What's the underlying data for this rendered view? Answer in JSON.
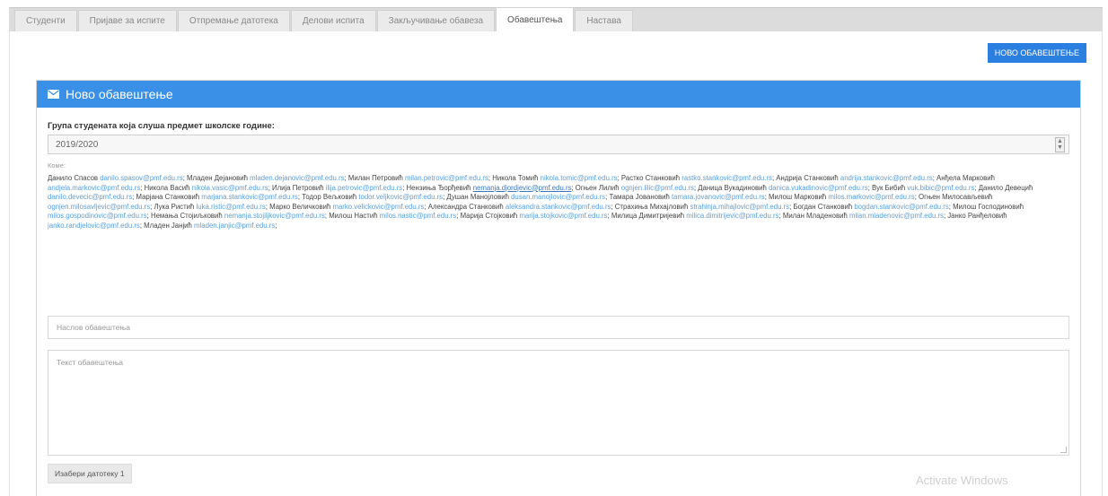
{
  "tabs": [
    {
      "label": "Студенти",
      "active": false
    },
    {
      "label": "Пријаве за испите",
      "active": false
    },
    {
      "label": "Отпремање датотека",
      "active": false
    },
    {
      "label": "Делови испита",
      "active": false
    },
    {
      "label": "Закључивање обавеза",
      "active": false
    },
    {
      "label": "Обавештења",
      "active": true
    },
    {
      "label": "Настава",
      "active": false
    }
  ],
  "new_notice_button": "НОВО ОБАВЕШТЕЊЕ",
  "panel": {
    "title": "Ново обавештење",
    "group_label": "Група студената која слуша предмет школске године:",
    "group_value": "2019/2020",
    "to_label": "Коме:",
    "recipients": [
      {
        "name": "Данило Спасов",
        "email": "danilo.spasov@pmf.edu.rs"
      },
      {
        "name": "Младен Дејановић",
        "email": "mladen.dejanovic@pmf.edu.rs"
      },
      {
        "name": "Милан Петровић",
        "email": "milan.petrovic@pmf.edu.rs"
      },
      {
        "name": "Никола Томић",
        "email": "nikola.tomic@pmf.edu.rs"
      },
      {
        "name": "Растко Станковић",
        "email": "rastko.stankovic@pmf.edu.rs"
      },
      {
        "name": "Андрија Станковић",
        "email": "andrija.stankovic@pmf.edu.rs"
      },
      {
        "name": "Анђела Марковић",
        "email": "andjela.markovic@pmf.edu.rs"
      },
      {
        "name": "Никола Васић",
        "email": "nikola.vasic@pmf.edu.rs"
      },
      {
        "name": "Илија Петровић",
        "email": "ilija.petrovic@pmf.edu.rs"
      },
      {
        "name": "Нензиња Ђорђевић",
        "email": "nemanja.djordjevic@pmf.edu.rs",
        "underline": true
      },
      {
        "name": "Огњен Лилић",
        "email": "ognjen.lilic@pmf.edu.rs"
      },
      {
        "name": "Даница Вукадиновић",
        "email": "danica.vukadinovic@pmf.edu.rs"
      },
      {
        "name": "Вук Бибић",
        "email": "vuk.bibic@pmf.edu.rs"
      },
      {
        "name": "Данило Девецић",
        "email": "danilo.devecic@pmf.edu.rs"
      },
      {
        "name": "Марјана Станковић",
        "email": "marjana.stankovic@pmf.edu.rs"
      },
      {
        "name": "Тодор Вељковић",
        "email": "todor.veljkovic@pmf.edu.rs"
      },
      {
        "name": "Душан Манојловић",
        "email": "dusan.manojlovic@pmf.edu.rs"
      },
      {
        "name": "Тамара Јовановић",
        "email": "tamara.jovanovic@pmf.edu.rs"
      },
      {
        "name": "Милош Марковић",
        "email": "milos.markovic@pmf.edu.rs"
      },
      {
        "name": "Огњен Милосављевић",
        "email": "ognjen.milosavljevic@pmf.edu.rs"
      },
      {
        "name": "Лука Ристић",
        "email": "luka.ristic@pmf.edu.rs"
      },
      {
        "name": "Марко Величковић",
        "email": "marko.velickovic@pmf.edu.rs"
      },
      {
        "name": "Александра Станковић",
        "email": "aleksandra.stankovic@pmf.edu.rs"
      },
      {
        "name": "Страхиња Михајловић",
        "email": "strahinja.mihajlovic@pmf.edu.rs"
      },
      {
        "name": "Богдан Станковић",
        "email": "bogdan.stankovic@pmf.edu.rs"
      },
      {
        "name": "Милош Господиновић",
        "email": "milos.gospodinovic@pmf.edu.rs"
      },
      {
        "name": "Немања Стојиљковић",
        "email": "nemanja.stojiljkovic@pmf.edu.rs"
      },
      {
        "name": "Милош Настић",
        "email": "milos.nastic@pmf.edu.rs"
      },
      {
        "name": "Марија Стојковић",
        "email": "marija.stojkovic@pmf.edu.rs"
      },
      {
        "name": "Милица Димитријевић",
        "email": "milica.dimitrijevic@pmf.edu.rs"
      },
      {
        "name": "Милан Младеновић",
        "email": "milan.mladenovic@pmf.edu.rs"
      },
      {
        "name": "Јанко Ранђеловић",
        "email": "janko.randjelovic@pmf.edu.rs"
      },
      {
        "name": "Младен Јанјић",
        "email": "mladen.janjic@pmf.edu.rs"
      }
    ],
    "title_placeholder": "Наслов обавештења",
    "text_placeholder": "Текст обавештења",
    "file_button": "Изабери датотеку 1"
  },
  "watermark": "Activate Windows",
  "colors": {
    "accent": "#3a8fe6",
    "button": "#2b7fe0",
    "link": "#5aa0dd"
  }
}
